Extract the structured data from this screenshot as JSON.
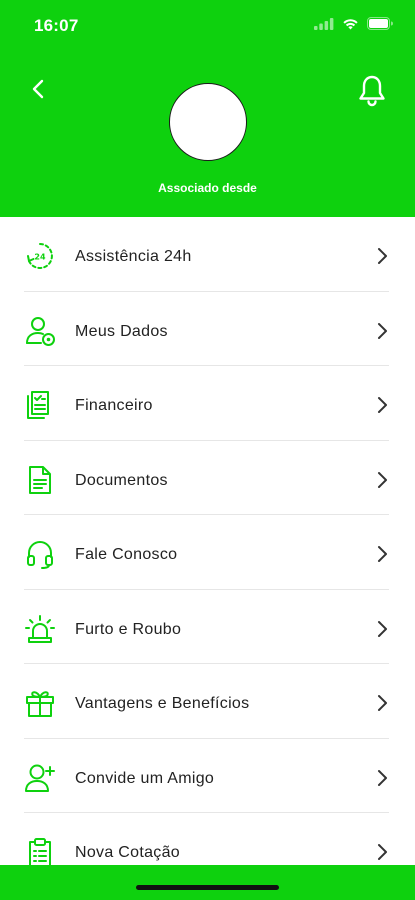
{
  "status_bar": {
    "time": "16:07"
  },
  "header": {
    "member_since": "Associado desde"
  },
  "menu": {
    "items": [
      {
        "label": "Assistência 24h",
        "icon": "assistance-24h-icon"
      },
      {
        "label": "Meus Dados",
        "icon": "user-settings-icon"
      },
      {
        "label": "Financeiro",
        "icon": "document-check-icon"
      },
      {
        "label": "Documentos",
        "icon": "file-icon"
      },
      {
        "label": "Fale Conosco",
        "icon": "headset-icon"
      },
      {
        "label": "Furto e Roubo",
        "icon": "alarm-siren-icon"
      },
      {
        "label": "Vantagens e Benefícios",
        "icon": "gift-icon"
      },
      {
        "label": "Convide um Amigo",
        "icon": "add-user-icon"
      },
      {
        "label": "Nova Cotação",
        "icon": "clipboard-icon"
      }
    ]
  },
  "colors": {
    "brand_green": "#0ed10e",
    "text": "#222222",
    "divider": "#e6e6e6"
  }
}
